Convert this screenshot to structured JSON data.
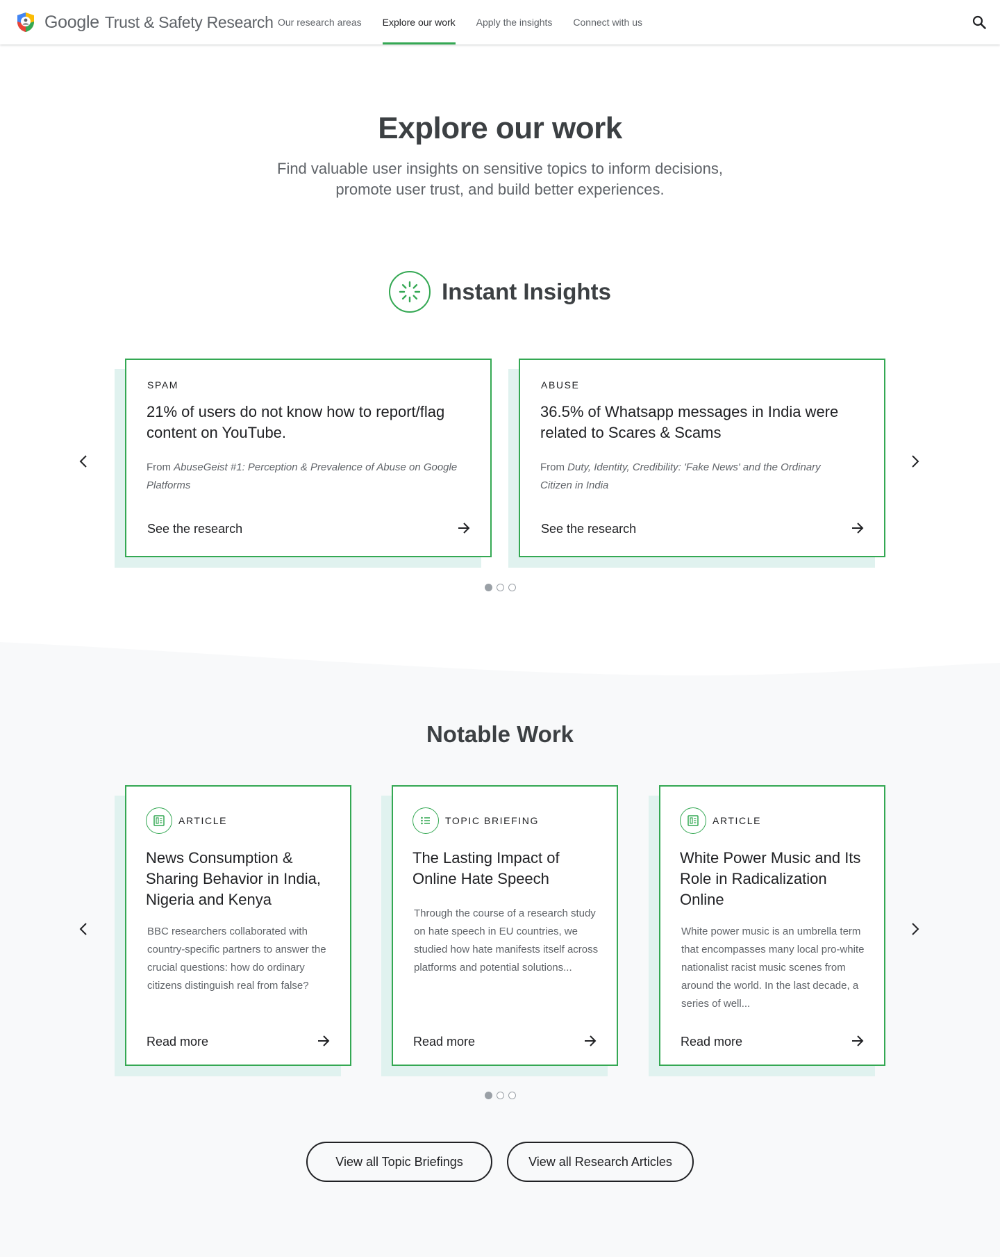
{
  "header": {
    "brand_google": "Google",
    "brand_product": "Trust & Safety Research",
    "nav": [
      {
        "label": "Our research areas",
        "active": false
      },
      {
        "label": "Explore our work",
        "active": true
      },
      {
        "label": "Apply the insights",
        "active": false
      },
      {
        "label": "Connect with us",
        "active": false
      }
    ],
    "search_icon": "search-icon"
  },
  "hero": {
    "title": "Explore our work",
    "subtitle": "Find valuable user insights on sensitive topics to inform decisions, promote user trust, and build better experiences."
  },
  "instant_insights": {
    "title": "Instant Insights",
    "icon": "loading-spinner-icon",
    "cards": [
      {
        "tag": "SPAM",
        "stat": "21% of users do not know how to report/flag content on YouTube.",
        "source_prefix": "From",
        "source_title": "AbuseGeist #1: Perception & Prevalence of Abuse on Google Platforms",
        "cta": "See the research"
      },
      {
        "tag": "ABUSE",
        "stat": "36.5% of Whatsapp messages in India were related to Scares & Scams",
        "source_prefix": "From",
        "source_title": "Duty, Identity, Credibility: 'Fake News' and the Ordinary Citizen in India",
        "cta": "See the research"
      }
    ],
    "pagination": {
      "pages": 3,
      "current": 1
    }
  },
  "notable_work": {
    "title": "Notable Work",
    "cards": [
      {
        "type": "ARTICLE",
        "icon": "article-icon",
        "title": "News Consumption & Sharing Behavior in India, Nigeria and Kenya",
        "description": "BBC researchers collaborated with country-specific partners to answer the crucial questions: how do ordinary citizens distinguish real from false?",
        "cta": "Read more"
      },
      {
        "type": "TOPIC BRIEFING",
        "icon": "list-icon",
        "title": "The Lasting Impact of Online Hate Speech",
        "description": "Through the course of a research study on hate speech in EU countries, we studied how hate manifests itself across platforms and potential solutions...",
        "cta": "Read more"
      },
      {
        "type": "ARTICLE",
        "icon": "article-icon",
        "title": "White Power Music and Its Role in Radicalization Online",
        "description": "White power music is an umbrella term that encompasses many local pro-white nationalist racist music scenes from around the world. In the last decade, a series of well...",
        "cta": "Read more"
      }
    ],
    "pagination": {
      "pages": 3,
      "current": 1
    },
    "buttons": {
      "topic_briefings": "View all Topic Briefings",
      "research_articles": "View all Research Articles"
    }
  },
  "colors": {
    "accent_green": "#34a853",
    "card_shadow": "#e0f2ef",
    "section_bg": "#f8f9fa",
    "text_dark": "#202124",
    "text_muted": "#5f6368"
  }
}
